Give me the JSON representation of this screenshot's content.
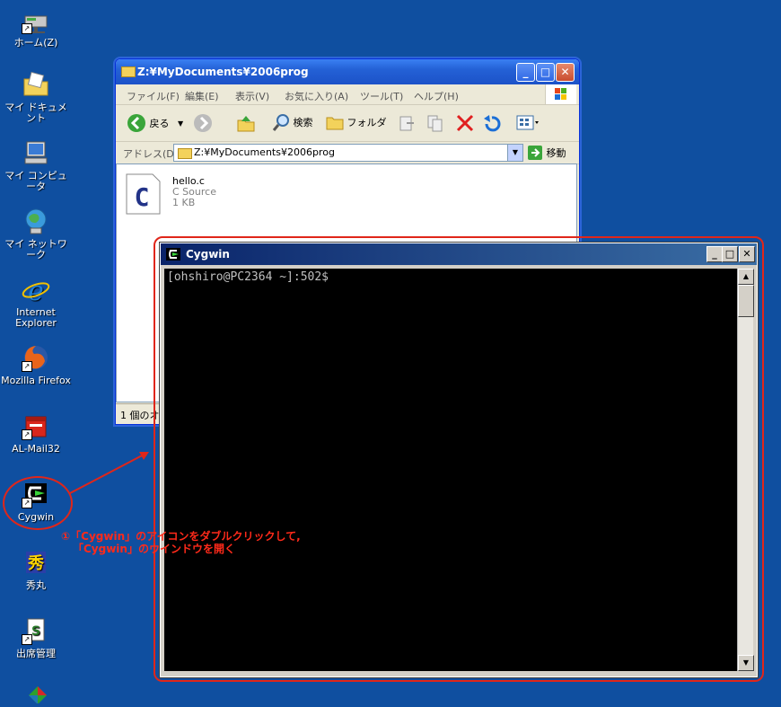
{
  "desktop": {
    "icons": [
      {
        "label": "ホーム(Z)",
        "icon": "network-drive-icon"
      },
      {
        "label": "マイ ドキュメント",
        "icon": "my-documents-icon"
      },
      {
        "label": "マイ コンピュータ",
        "icon": "my-computer-icon"
      },
      {
        "label": "マイ ネットワーク",
        "icon": "network-places-icon"
      },
      {
        "label": "Internet\nExplorer",
        "icon": "internet-explorer-icon"
      },
      {
        "label": "Mozilla Firefox",
        "icon": "firefox-icon"
      },
      {
        "label": "AL-Mail32",
        "icon": "mailbox-icon"
      },
      {
        "label": "Cygwin",
        "icon": "cygwin-icon"
      },
      {
        "label": "秀丸",
        "icon": "hidemaru-icon"
      },
      {
        "label": "出席管理",
        "icon": "attendance-icon"
      }
    ]
  },
  "explorer": {
    "title": "Z:¥MyDocuments¥2006prog",
    "menu": [
      "ファイル(F)",
      "編集(E)",
      "表示(V)",
      "お気に入り(A)",
      "ツール(T)",
      "ヘルプ(H)"
    ],
    "toolbar": {
      "back": "戻る",
      "search": "検索",
      "folders": "フォルダ"
    },
    "address": {
      "label": "アドレス(D)",
      "value": "Z:¥MyDocuments¥2006prog",
      "go": "移動"
    },
    "files": [
      {
        "name": "hello.c",
        "type": "C Source",
        "size": "1 KB",
        "icon": "c-source-file-icon"
      }
    ],
    "status": "1 個のオ"
  },
  "cygwin": {
    "title": "Cygwin",
    "prompt": "[ohshiro@PC2364 ~]:502$"
  },
  "annotation": {
    "line1": "①「Cygwin」のアイコンをダブルクリックして,",
    "line2": "「Cygwin」のウインドウを開く",
    "color": "#ff2a1a"
  }
}
